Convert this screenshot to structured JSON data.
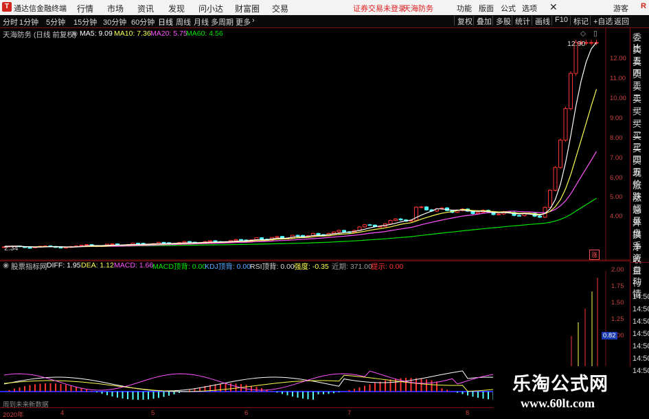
{
  "menubar": {
    "app_title": "通达信金融终端",
    "items": [
      "行情",
      "市场",
      "资讯",
      "发现",
      "问小达",
      "财富圈",
      "交易"
    ],
    "warning": "证券交易未登录",
    "stock_name": "天海防务",
    "right_items": [
      "功能",
      "版面",
      "公式",
      "选项"
    ],
    "user": "游客"
  },
  "toolbar": {
    "periods": [
      "分时",
      "1分钟",
      "5分钟",
      "15分钟",
      "30分钟",
      "60分钟",
      "日线",
      "周线",
      "月线",
      "多周期",
      "更多"
    ],
    "active_period": "日线",
    "right_buttons": [
      "复权",
      "叠加",
      "多股",
      "统计",
      "画线",
      "F10",
      "标记",
      "+自选",
      "返回"
    ]
  },
  "main_chart": {
    "title": "天海防务 (日线 前复权)",
    "ma5": "MA5: 9.09",
    "ma10": "MA10: 7.36",
    "ma20": "MA20: 5.75",
    "ma60": "MA60: 4.56",
    "high_label": "12.90",
    "low_label": "2.34",
    "corner_label": "涨"
  },
  "price_axis": [
    "12.00",
    "11.00",
    "10.00",
    "9.00",
    "8.00",
    "7.00",
    "6.00",
    "5.00",
    "4.00"
  ],
  "indicator": {
    "title": "股票指标网",
    "diff": "DIFF: 1.95",
    "dea": "DEA: 1.12",
    "macd": "MACD: 1.66",
    "macd_div": "MACD顶背: 0.00",
    "kdj_div": "KDJ顶背: 0.00",
    "rsi_div": "RSI顶背: 0.00",
    "strength": "强度: -0.35",
    "recent": "近期: 371.00",
    "alert": "提示: 0.00",
    "axis": [
      "2.00",
      "1.75",
      "1.50",
      "1.25",
      "1.00"
    ],
    "current": "0.82",
    "footer": "周到未来新数据"
  },
  "date_axis": [
    "2020年",
    "4",
    "5",
    "6",
    "7",
    "8"
  ],
  "right_panel": {
    "items": [
      "委比",
      "卖五",
      "卖四",
      "卖三",
      "卖二",
      "卖一",
      "买一",
      "买二",
      "买三",
      "买四",
      "买五",
      "现价",
      "涨跌",
      "涨幅",
      "总量",
      "外盘",
      "换手",
      "净资",
      "收益"
    ],
    "lower_items": [
      "自动",
      "行情",
      "14:50",
      "14:50",
      "14:50",
      "14:50",
      "14:50",
      "14:50",
      "14:50"
    ]
  },
  "watermark": {
    "line1": "乐淘公式网",
    "line2": "www.60lt.com"
  },
  "colors": {
    "up": "#ff3232",
    "down": "#54ffff",
    "ma5": "#ffffff",
    "ma10": "#ffff54",
    "ma20": "#ff54ff",
    "ma60": "#00e600",
    "axis": "#7a1010"
  }
}
